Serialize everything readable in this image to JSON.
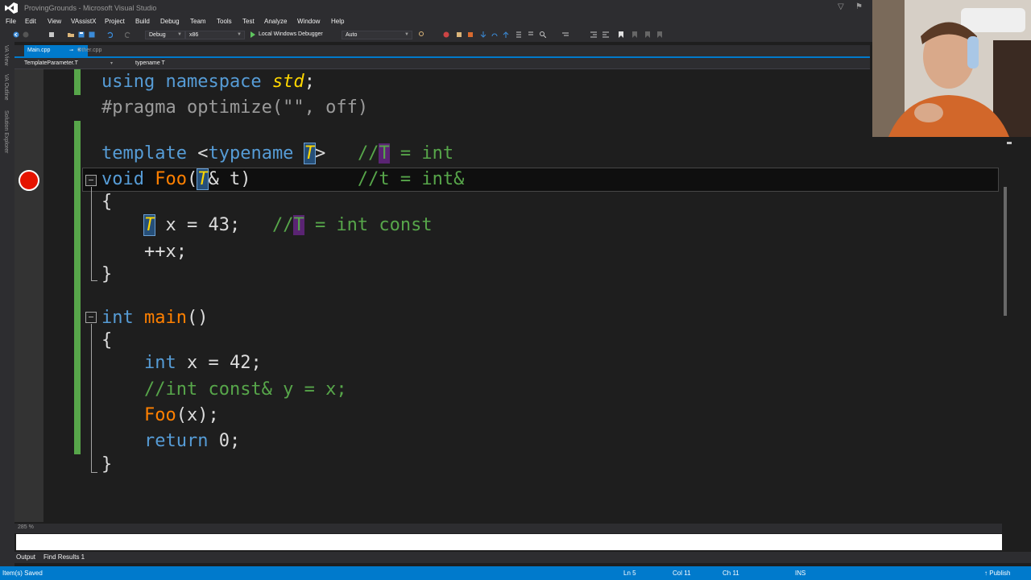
{
  "window": {
    "title": "ProvingGrounds - Microsoft Visual Studio"
  },
  "menu": [
    "File",
    "Edit",
    "View",
    "VAssistX",
    "Project",
    "Build",
    "Debug",
    "Team",
    "Tools",
    "Test",
    "Analyze",
    "Window",
    "Help"
  ],
  "toolbar": {
    "config": "Debug",
    "platform": "x86",
    "debugger": "Local Windows Debugger",
    "debugger_mode": "Auto"
  },
  "side_tabs": [
    "VA View",
    "VA Outline",
    "Solution Explorer"
  ],
  "doc_tabs": [
    {
      "label": "Main.cpp",
      "active": true
    },
    {
      "label": "Other.cpp",
      "active": false
    }
  ],
  "navbar": {
    "scope": "TemplateParameter.T",
    "member": "typename T"
  },
  "code": {
    "line1": {
      "kw": "using namespace",
      "ns": "std",
      "punct": ";"
    },
    "line2": {
      "text": "#pragma optimize(\"\", off)"
    },
    "line3": {
      "kw": "template",
      "open": " <",
      "kw2": "typename",
      "param": "T",
      "close": ">",
      "cm_a": "//",
      "cm_param": "T",
      "cm_b": " = int"
    },
    "line4": {
      "kw": "void",
      "fn": "Foo",
      "open": "(",
      "param": "T",
      "rest": "& t)",
      "cm": "//t = int&"
    },
    "line5": {
      "text": "{"
    },
    "line6": {
      "param": "T",
      "rest": " x = 43;",
      "cm_a": "//",
      "cm_param": "T",
      "cm_b": " = int const"
    },
    "line7": {
      "text": "++x;"
    },
    "line8": {
      "text": "}"
    },
    "line9": {
      "kw": "int",
      "fn": "main",
      "rest": "()"
    },
    "line10": {
      "text": "{"
    },
    "line11": {
      "kw": "int",
      "rest": " x = 42;"
    },
    "line12": {
      "cm": "//int const& y = x;"
    },
    "line13": {
      "fn": "Foo",
      "rest": "(x);"
    },
    "line14": {
      "kw": "return",
      "rest": " 0;"
    },
    "line15": {
      "text": "}"
    }
  },
  "editor": {
    "zoom": "285 %"
  },
  "bottom_tabs": [
    "Output",
    "Find Results 1"
  ],
  "status": {
    "message": "Item(s) Saved",
    "line": "Ln 5",
    "col": "Col 11",
    "ch": "Ch 11",
    "mode": "INS",
    "publish": "Publish"
  }
}
